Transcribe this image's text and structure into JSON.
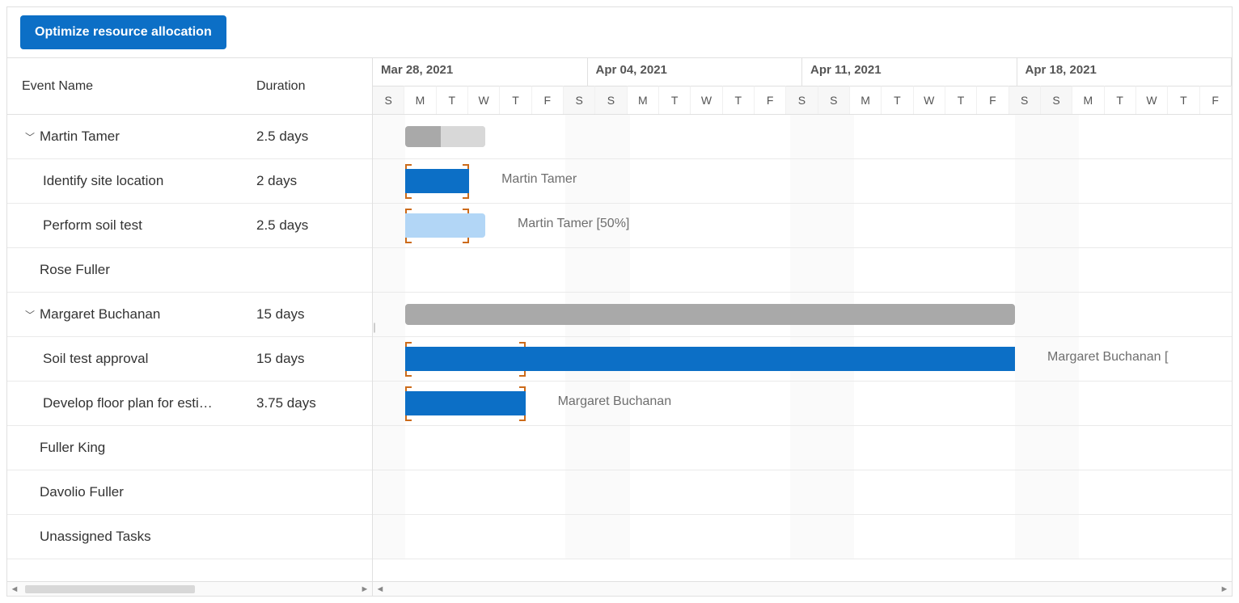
{
  "toolbar": {
    "optimize_label": "Optimize resource allocation"
  },
  "columns": {
    "name": "Event Name",
    "duration": "Duration"
  },
  "weeks": [
    "Mar 28, 2021",
    "Apr 04, 2021",
    "Apr 11, 2021",
    "Apr 18, 2021"
  ],
  "dayLetters": [
    "S",
    "M",
    "T",
    "W",
    "T",
    "F",
    "S"
  ],
  "rows": [
    {
      "id": "r0",
      "name": "Martin Tamer",
      "duration": "2.5 days",
      "level": 0,
      "expandable": true
    },
    {
      "id": "r1",
      "name": "Identify site location",
      "duration": "2 days",
      "level": 1
    },
    {
      "id": "r2",
      "name": "Perform soil test",
      "duration": "2.5 days",
      "level": 1
    },
    {
      "id": "r3",
      "name": "Rose Fuller",
      "duration": "",
      "level": 0
    },
    {
      "id": "r4",
      "name": "Margaret Buchanan",
      "duration": "15 days",
      "level": 0,
      "expandable": true
    },
    {
      "id": "r5",
      "name": "Soil test approval",
      "duration": "15 days",
      "level": 1
    },
    {
      "id": "r6",
      "name": "Develop floor plan for esti…",
      "duration": "3.75 days",
      "level": 1
    },
    {
      "id": "r7",
      "name": "Fuller King",
      "duration": "",
      "level": 0
    },
    {
      "id": "r8",
      "name": "Davolio Fuller",
      "duration": "",
      "level": 0
    },
    {
      "id": "r9",
      "name": "Unassigned Tasks",
      "duration": "",
      "level": 0
    }
  ],
  "barLabels": {
    "r1": "Martin Tamer",
    "r2": "Martin Tamer [50%]",
    "r5": "Margaret Buchanan [",
    "r6": "Margaret Buchanan"
  },
  "chart_data": {
    "type": "gantt",
    "start_date": "2021-03-28",
    "unit": "days",
    "tasks": [
      {
        "id": "r0",
        "type": "summary",
        "resource": "Martin Tamer",
        "start": "2021-03-29",
        "duration_days": 2.5,
        "progress": 0.45
      },
      {
        "id": "r1",
        "type": "task",
        "name": "Identify site location",
        "resource": "Martin Tamer",
        "start": "2021-03-29",
        "duration_days": 2,
        "allocation": 100
      },
      {
        "id": "r2",
        "type": "task",
        "name": "Perform soil test",
        "resource": "Martin Tamer",
        "start": "2021-03-29",
        "duration_days": 2.5,
        "allocation": 50
      },
      {
        "id": "r4",
        "type": "summary",
        "resource": "Margaret Buchanan",
        "start": "2021-03-29",
        "duration_days": 19
      },
      {
        "id": "r5",
        "type": "task",
        "name": "Soil test approval",
        "resource": "Margaret Buchanan",
        "start": "2021-03-29",
        "duration_days": 19,
        "allocation": 100
      },
      {
        "id": "r6",
        "type": "task",
        "name": "Develop floor plan for estimation",
        "resource": "Margaret Buchanan",
        "start": "2021-03-29",
        "duration_days": 3.75,
        "allocation": 100
      }
    ]
  }
}
